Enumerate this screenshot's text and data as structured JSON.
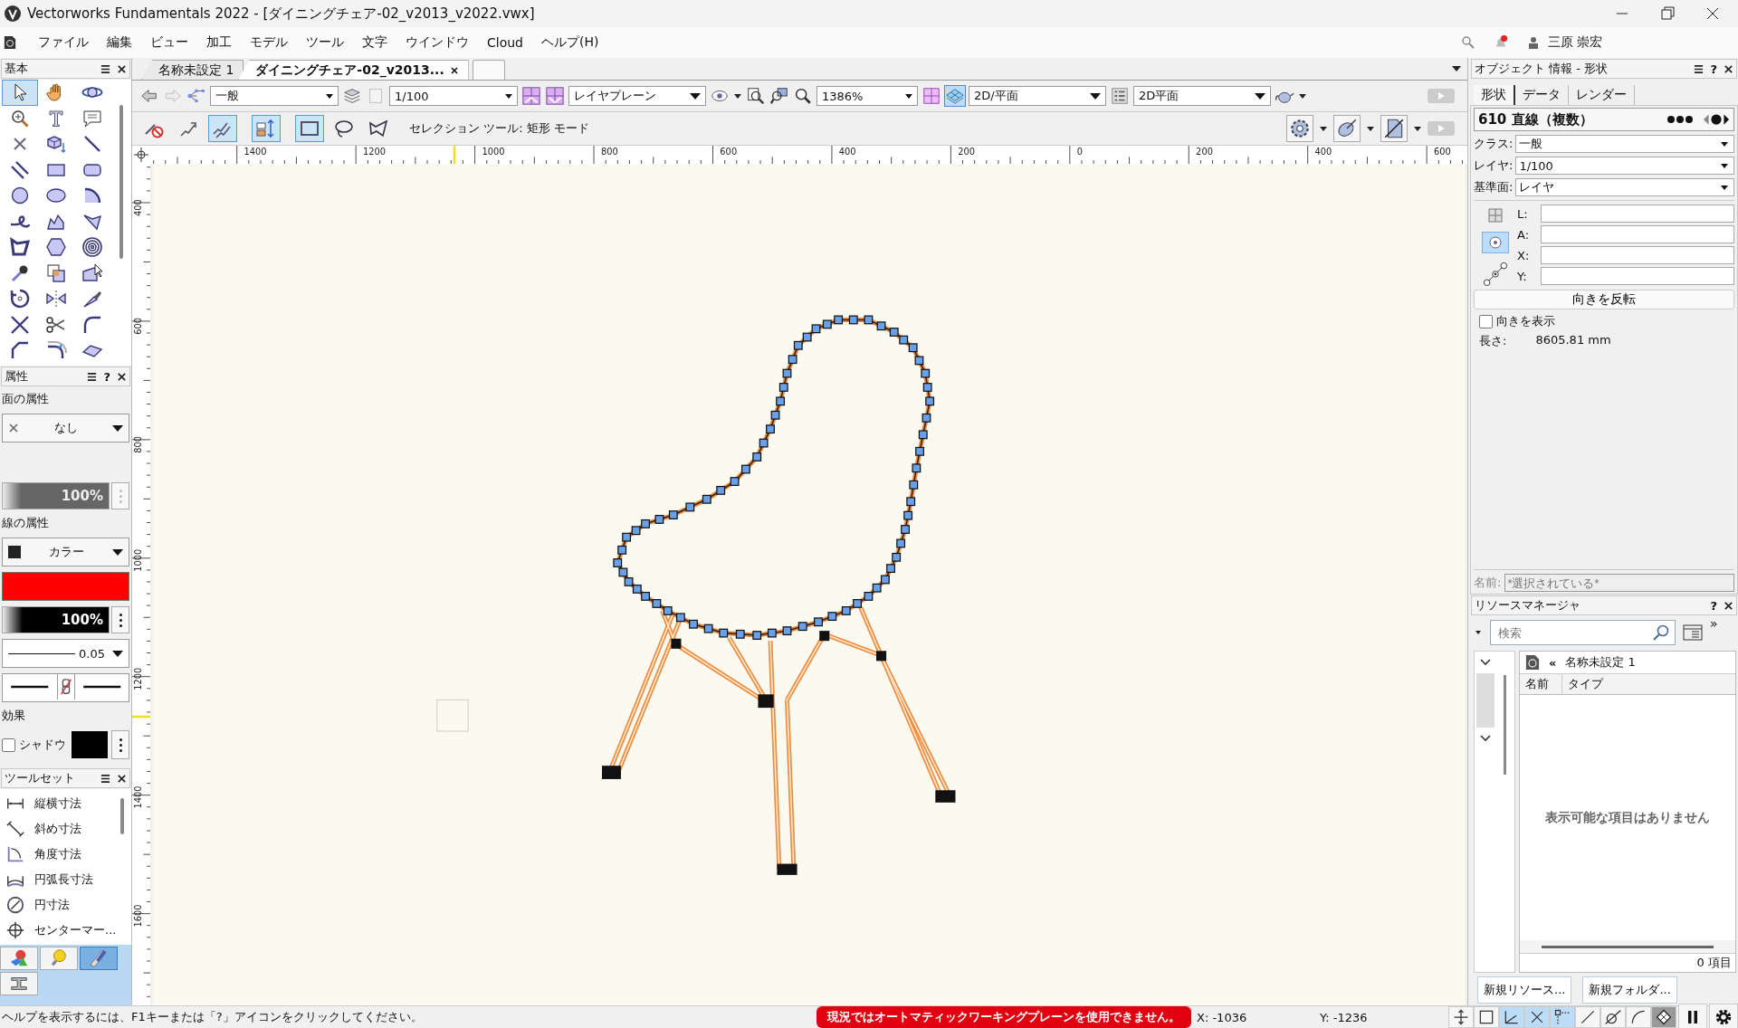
{
  "window": {
    "title": "Vectorworks Fundamentals 2022 - [ダイニングチェア-02_v2013_v2022.vwx]"
  },
  "menu": [
    "ファイル",
    "編集",
    "ビュー",
    "加工",
    "モデル",
    "ツール",
    "文字",
    "ウインドウ",
    "Cloud",
    "ヘルプ(H)"
  ],
  "user": {
    "name": "三原 崇宏"
  },
  "tool_palette": {
    "title": "基本",
    "tools": [
      {
        "kind": "arrow",
        "selected": true
      },
      {
        "kind": "hand",
        "selected": false
      },
      {
        "kind": "orbit",
        "selected": false
      },
      {
        "kind": "zoom",
        "selected": false
      },
      {
        "kind": "text",
        "selected": false
      },
      {
        "kind": "callout",
        "selected": false
      },
      {
        "kind": "xmark",
        "selected": false
      },
      {
        "kind": "pushpull",
        "selected": false
      },
      {
        "kind": "line",
        "selected": false
      },
      {
        "kind": "dline",
        "selected": false
      },
      {
        "kind": "rect",
        "selected": false
      },
      {
        "kind": "rrect",
        "selected": false
      },
      {
        "kind": "circle",
        "selected": false
      },
      {
        "kind": "oval",
        "selected": false
      },
      {
        "kind": "arc",
        "selected": false
      },
      {
        "kind": "freehand",
        "selected": false
      },
      {
        "kind": "polyline",
        "selected": false
      },
      {
        "kind": "polygon",
        "selected": false
      },
      {
        "kind": "dpoly",
        "selected": false
      },
      {
        "kind": "hexagon",
        "selected": false
      },
      {
        "kind": "spiral",
        "selected": false
      },
      {
        "kind": "eyedropper",
        "selected": false
      },
      {
        "kind": "attrmap",
        "selected": false
      },
      {
        "kind": "reshape",
        "selected": false
      },
      {
        "kind": "rotate",
        "selected": false
      },
      {
        "kind": "mirror",
        "selected": false
      },
      {
        "kind": "knife",
        "selected": false
      },
      {
        "kind": "cross",
        "selected": false
      },
      {
        "kind": "scissors",
        "selected": false
      },
      {
        "kind": "fillet",
        "selected": false
      },
      {
        "kind": "chamfer",
        "selected": false
      },
      {
        "kind": "offset",
        "selected": false
      },
      {
        "kind": "eraser",
        "selected": false
      }
    ]
  },
  "attributes": {
    "title": "属性",
    "help": "?",
    "fill_heading": "面の属性",
    "fill_style": "なし",
    "fill_opacity": "100%",
    "line_heading": "線の属性",
    "line_style": "カラー",
    "line_opacity": "100%",
    "line_weight": "0.05",
    "effects_heading": "効果",
    "shadow": {
      "label": "シャドウ",
      "checked": false
    }
  },
  "toolset": {
    "title": "ツールセット",
    "items": [
      {
        "kind": "dim-h",
        "label": "縦横寸法"
      },
      {
        "kind": "dim-d",
        "label": "斜め寸法"
      },
      {
        "kind": "angle",
        "label": "角度寸法"
      },
      {
        "kind": "arclen",
        "label": "円弧長寸法"
      },
      {
        "kind": "radial",
        "label": "円寸法"
      },
      {
        "kind": "center",
        "label": "センターマー..."
      }
    ],
    "categories": [
      {
        "kind": "shapes",
        "selected": false
      },
      {
        "kind": "bulb",
        "selected": false
      },
      {
        "kind": "pencil",
        "selected": true
      },
      {
        "kind": "beam",
        "selected": false
      }
    ]
  },
  "document_tabs": [
    {
      "label": "名称未設定 1",
      "selected": false
    },
    {
      "label": "ダイニングチェア-02_v2013...",
      "selected": true
    }
  ],
  "view_bar": {
    "class": "一般",
    "layer": "1/100",
    "plane": "レイヤプレーン",
    "zoom": "1386%",
    "view": "2D/平面",
    "render": "2D平面"
  },
  "mode_bar": {
    "modes": [
      {
        "kind": "noedit",
        "selected": false
      },
      {
        "kind": "single",
        "selected": false
      },
      {
        "kind": "multi",
        "selected": true
      },
      {
        "kind": "transform",
        "selected": true
      },
      {
        "kind": "marquee",
        "selected": true
      },
      {
        "kind": "lasso",
        "selected": false
      },
      {
        "kind": "polymarquee",
        "selected": false
      }
    ],
    "hint": "セレクション ツール: 矩形 モード"
  },
  "rulers": {
    "horizontal": [
      "1400",
      "1200",
      "1000",
      "800",
      "600",
      "400",
      "200",
      "0",
      "200",
      "400",
      "600"
    ],
    "vertical": [
      "400",
      "600",
      "800",
      "1000",
      "1200",
      "1400",
      "1600"
    ]
  },
  "object_info": {
    "title": "オブジェクト 情報 - 形状",
    "help": "?",
    "tabs": [
      {
        "label": "形状",
        "selected": true
      },
      {
        "label": "データ",
        "selected": false
      },
      {
        "label": "レンダー",
        "selected": false
      }
    ],
    "summary": "610 直線（複数）",
    "fields": [
      {
        "label": "クラス:",
        "value": "一般"
      },
      {
        "label": "レイヤ:",
        "value": "1/100"
      },
      {
        "label": "基準面:",
        "value": "レイヤ"
      }
    ],
    "coords": [
      "L:",
      "A:",
      "X:",
      "Y:"
    ],
    "reverse_button": "向きを反転",
    "show_direction": {
      "label": "向きを表示",
      "checked": false
    },
    "length_label": "長さ:",
    "length_value": "8605.81 mm",
    "name_label": "名前:",
    "name_placeholder": "*選択されている*"
  },
  "resource_manager": {
    "title": "リソースマネージャ",
    "help": "?",
    "expand": "»",
    "search_placeholder": "検索",
    "collapse": "«",
    "file": "名称未設定 1",
    "columns": [
      "名前",
      "タイプ"
    ],
    "empty_message": "表示可能な項目はありません",
    "count": "0 項目",
    "buttons": [
      "新規リソース...",
      "新規フォルダ..."
    ]
  },
  "status_bar": {
    "help": "ヘルプを表示するには、F1キーまたは「?」アイコンをクリックしてください。",
    "warning": "現況ではオートマティックワーキングプレーンを使用できません。",
    "x": "X: -1036",
    "y": "Y: -1236",
    "snaps": [
      {
        "kind": "arrows",
        "selected": false
      },
      {
        "kind": "square",
        "selected": false
      },
      {
        "kind": "angle",
        "selected": true
      },
      {
        "kind": "x",
        "selected": true
      },
      {
        "kind": "dotted",
        "selected": true
      },
      {
        "kind": "line",
        "selected": false
      },
      {
        "kind": "tangent",
        "selected": false
      },
      {
        "kind": "arc",
        "selected": false
      },
      {
        "kind": "diamond",
        "selected": true
      }
    ]
  }
}
